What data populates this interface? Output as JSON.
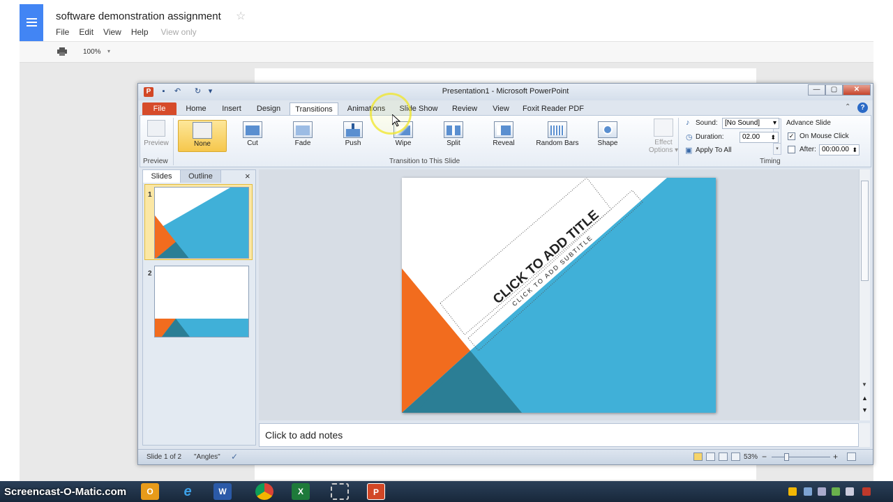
{
  "gdocs": {
    "title": "software demonstration assignment",
    "star": "☆",
    "menu": [
      "File",
      "Edit",
      "View",
      "Help"
    ],
    "view_only": "View only",
    "zoom": "100%",
    "zoom_caret": "▾"
  },
  "ppt": {
    "window_title": "Presentation1 - Microsoft PowerPoint",
    "app_icon": "P",
    "qat_icons": [
      "save-icon",
      "undo-icon",
      "redo-icon",
      "customize-icon"
    ],
    "qat_glyphs": [
      "▪",
      "↶",
      "↻",
      "▾"
    ],
    "window_buttons": {
      "min": "—",
      "max": "▢",
      "close": "✕"
    },
    "tabs": [
      "File",
      "Home",
      "Insert",
      "Design",
      "Transitions",
      "Animations",
      "Slide Show",
      "Review",
      "View",
      "Foxit Reader PDF"
    ],
    "active_tab": "Transitions",
    "help_icon": "?",
    "ribbon_minimize": "⌃",
    "ribbon": {
      "preview_label": "Preview",
      "preview_group": "Preview",
      "transitions": [
        "None",
        "Cut",
        "Fade",
        "Push",
        "Wipe",
        "Split",
        "Reveal",
        "Random Bars",
        "Shape"
      ],
      "selected_transition": "None",
      "scroll_glyphs": [
        "▲",
        "▼",
        "▾"
      ],
      "transition_group": "Transition to This Slide",
      "effect_options_line1": "Effect",
      "effect_options_line2": "Options ▾",
      "timing": {
        "sound_label": "Sound:",
        "sound_value": "[No Sound]",
        "duration_label": "Duration:",
        "duration_value": "02.00",
        "apply_all": "Apply To All",
        "advance_label": "Advance Slide",
        "on_mouse_click": "On Mouse Click",
        "on_mouse_click_checked": true,
        "check_glyph": "✓",
        "after_label": "After:",
        "after_value": "00:00.00",
        "after_checked": false,
        "group_label": "Timing",
        "dropdown_glyph": "▾",
        "spinner_glyph": "⬍"
      }
    },
    "panel": {
      "tab_slides": "Slides",
      "tab_outline": "Outline",
      "close": "×",
      "slide_numbers": [
        "1",
        "2"
      ]
    },
    "slide": {
      "title": "CLICK TO ADD TITLE",
      "subtitle": "CLICK TO ADD SUBTITLE"
    },
    "notes_placeholder": "Click to add notes",
    "status": {
      "slide_pos": "Slide 1 of 2",
      "theme": "\"Angles\"",
      "zoom": "53%",
      "zoom_minus": "−",
      "zoom_plus": "+"
    },
    "colors": {
      "blue": "#40b0d8",
      "orange": "#f26c1e",
      "dark_teal": "#2b7e95"
    }
  },
  "taskbar": {
    "watermark": "Screencast-O-Matic.com",
    "apps": [
      "outlook-icon",
      "ie-icon",
      "word-icon",
      "chrome-icon",
      "excel-icon",
      "snipping-icon",
      "powerpoint-icon"
    ],
    "app_glyphs": [
      "O",
      "e",
      "W",
      "",
      "X",
      "",
      "P"
    ]
  }
}
